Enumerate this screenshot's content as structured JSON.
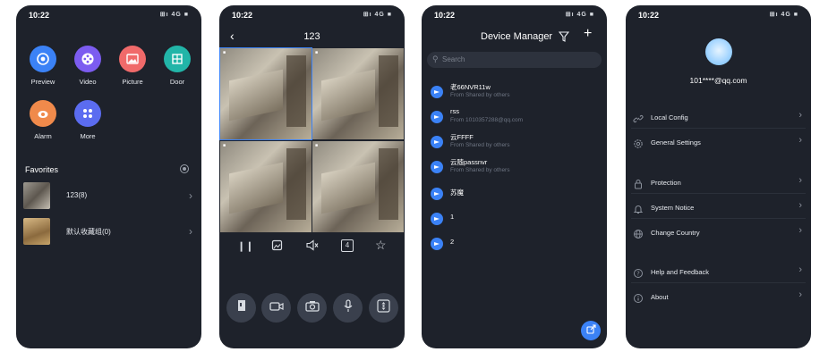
{
  "status": {
    "time": "10:22",
    "signal": "⊞ı 4G ■"
  },
  "home": {
    "apps": [
      {
        "label": "Preview",
        "color": "#3b82f6",
        "icon": "preview-icon"
      },
      {
        "label": "Video",
        "color": "#7c5cf0",
        "icon": "video-icon"
      },
      {
        "label": "Picture",
        "color": "#f06a6a",
        "icon": "picture-icon"
      },
      {
        "label": "Door",
        "color": "#22b5a8",
        "icon": "door-icon"
      },
      {
        "label": "Alarm",
        "color": "#f08a4b",
        "icon": "alarm-icon"
      },
      {
        "label": "More",
        "color": "#5b6cf0",
        "icon": "more-icon"
      }
    ],
    "favorites_title": "Favorites",
    "favorites": [
      {
        "name": "123(8)"
      },
      {
        "name": "默认收藏组(0)"
      }
    ]
  },
  "live": {
    "title": "123",
    "controls": [
      "pause-icon",
      "snapshot-icon",
      "mute-icon",
      "split-4-icon",
      "favorite-icon"
    ],
    "split_label": "4",
    "actions": [
      "door-control-icon",
      "record-icon",
      "camera-icon",
      "microphone-icon",
      "ptz-icon"
    ]
  },
  "devices": {
    "title": "Device Manager",
    "search_placeholder": "Search",
    "items": [
      {
        "name": "老66NVR11w",
        "sub": "From Shared by others"
      },
      {
        "name": "rss",
        "sub": "From 1010357288@qq.com"
      },
      {
        "name": "云FFFF",
        "sub": "From Shared by others"
      },
      {
        "name": "云随passnvr",
        "sub": "From Shared by others"
      },
      {
        "name": "苏魔",
        "sub": ""
      },
      {
        "name": "1",
        "sub": ""
      },
      {
        "name": "2",
        "sub": ""
      }
    ]
  },
  "profile": {
    "email": "101****@qq.com",
    "menu": [
      {
        "label": "Local Config",
        "icon": "link-icon"
      },
      {
        "label": "General Settings",
        "icon": "gear-icon"
      },
      {
        "label": "Protection",
        "icon": "lock-icon"
      },
      {
        "label": "System Notice",
        "icon": "bell-icon"
      },
      {
        "label": "Change Country",
        "icon": "globe-icon"
      },
      {
        "label": "Help and Feedback",
        "icon": "help-icon"
      },
      {
        "label": "About",
        "icon": "info-icon"
      }
    ]
  }
}
